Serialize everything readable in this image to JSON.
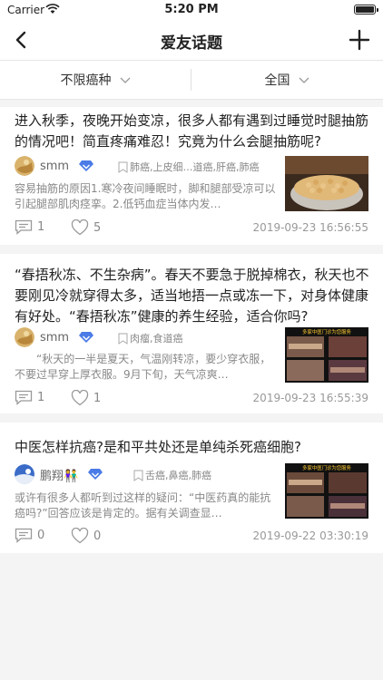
{
  "status_bar": {
    "carrier": "Carrier",
    "time": "5:20 PM"
  },
  "nav": {
    "title": "爱友话题"
  },
  "filters": {
    "cancer_type": "不限癌种",
    "region": "全国"
  },
  "posts": [
    {
      "title": "进入秋季，夜晚开始变凉，很多人都有遇到过睡觉时腿抽筋的情况吧！简直疼痛难忍！究竟为什么会腿抽筋呢?",
      "author": "smm",
      "tags": "肺癌,上皮细…道癌,肝癌,肺癌",
      "excerpt": "容易抽筋的原因1.寒冷夜间睡眠时，脚和腿部受凉可以引起腿部肌肉痉挛。2.低钙血症当体内发…",
      "comments": "1",
      "likes": "5",
      "datetime": "2019-09-23 16:56:55"
    },
    {
      "title": "“春捂秋冻、不生杂病”。春天不要急于脱掉棉衣，秋天也不要刚见冷就穿得太多，适当地捂一点或冻一下，对身体健康有好处。“春捂秋冻”健康的养生经验，适合你吗?",
      "author": "smm",
      "tags": "肉瘤,食道癌",
      "excerpt": "“秋天的一半是夏天，气温刚转凉，要少穿衣服，不要过早穿上厚衣服。9月下旬，天气凉爽…",
      "comments": "1",
      "likes": "1",
      "datetime": "2019-09-23 16:55:39"
    },
    {
      "title": "中医怎样抗癌?是和平共处还是单纯杀死癌细胞?",
      "author": "鹏翔👫",
      "tags": "舌癌,鼻癌,肺癌",
      "excerpt": "或许有很多人都听到过这样的疑问：“中医药真的能抗癌吗?”回答应该是肯定的。据有关调查显…",
      "comments": "0",
      "likes": "0",
      "datetime": "2019-09-22 03:30:19"
    }
  ],
  "thumb_caption": "多家中医门诊为您服务",
  "icons": {
    "back": "chevron-left-icon",
    "add": "plus-icon",
    "filter": "chevron-down-icon",
    "vip": "diamond-badge-icon",
    "tag": "bookmark-icon",
    "comment": "comment-icon",
    "like": "heart-icon"
  },
  "colors": {
    "vip_badge": "#4a7be6",
    "divider": "#f4f4f4",
    "meta": "#888888"
  }
}
